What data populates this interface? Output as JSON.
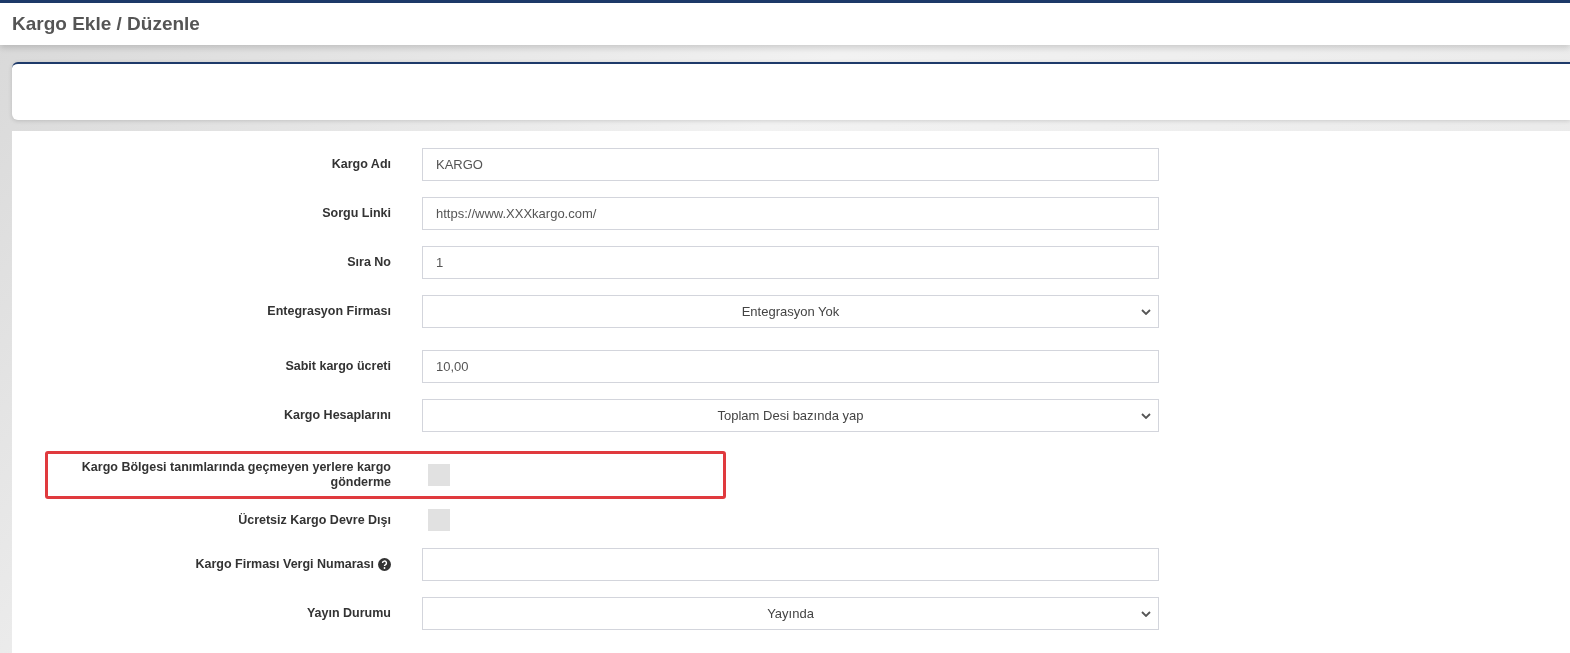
{
  "page": {
    "title": "Kargo Ekle / Düzenle"
  },
  "form": {
    "rows": [
      {
        "kind": "text",
        "label": "Kargo Adı",
        "value": "KARGO"
      },
      {
        "kind": "text",
        "label": "Sorgu Linki",
        "value": "https://www.XXXkargo.com/"
      },
      {
        "kind": "text",
        "label": "Sıra No",
        "value": "1"
      },
      {
        "kind": "select",
        "label": "Entegrasyon Firması",
        "value": "Entegrasyon Yok"
      },
      {
        "kind": "text",
        "label": "Sabit kargo ücreti",
        "value": "10,00"
      },
      {
        "kind": "select",
        "label": "Kargo Hesaplarını",
        "value": "Toplam Desi bazında yap"
      },
      {
        "kind": "checkbox",
        "label": "Kargo Bölgesi tanımlarında geçmeyen yerlere kargo gönderme",
        "checked": false,
        "highlighted": true
      },
      {
        "kind": "checkbox",
        "label": "Ücretsiz Kargo Devre Dışı",
        "checked": false
      },
      {
        "kind": "text",
        "label": "Kargo Firması Vergi Numarası",
        "value": "",
        "help": true
      },
      {
        "kind": "select",
        "label": "Yayın Durumu",
        "value": "Yayında"
      }
    ]
  }
}
